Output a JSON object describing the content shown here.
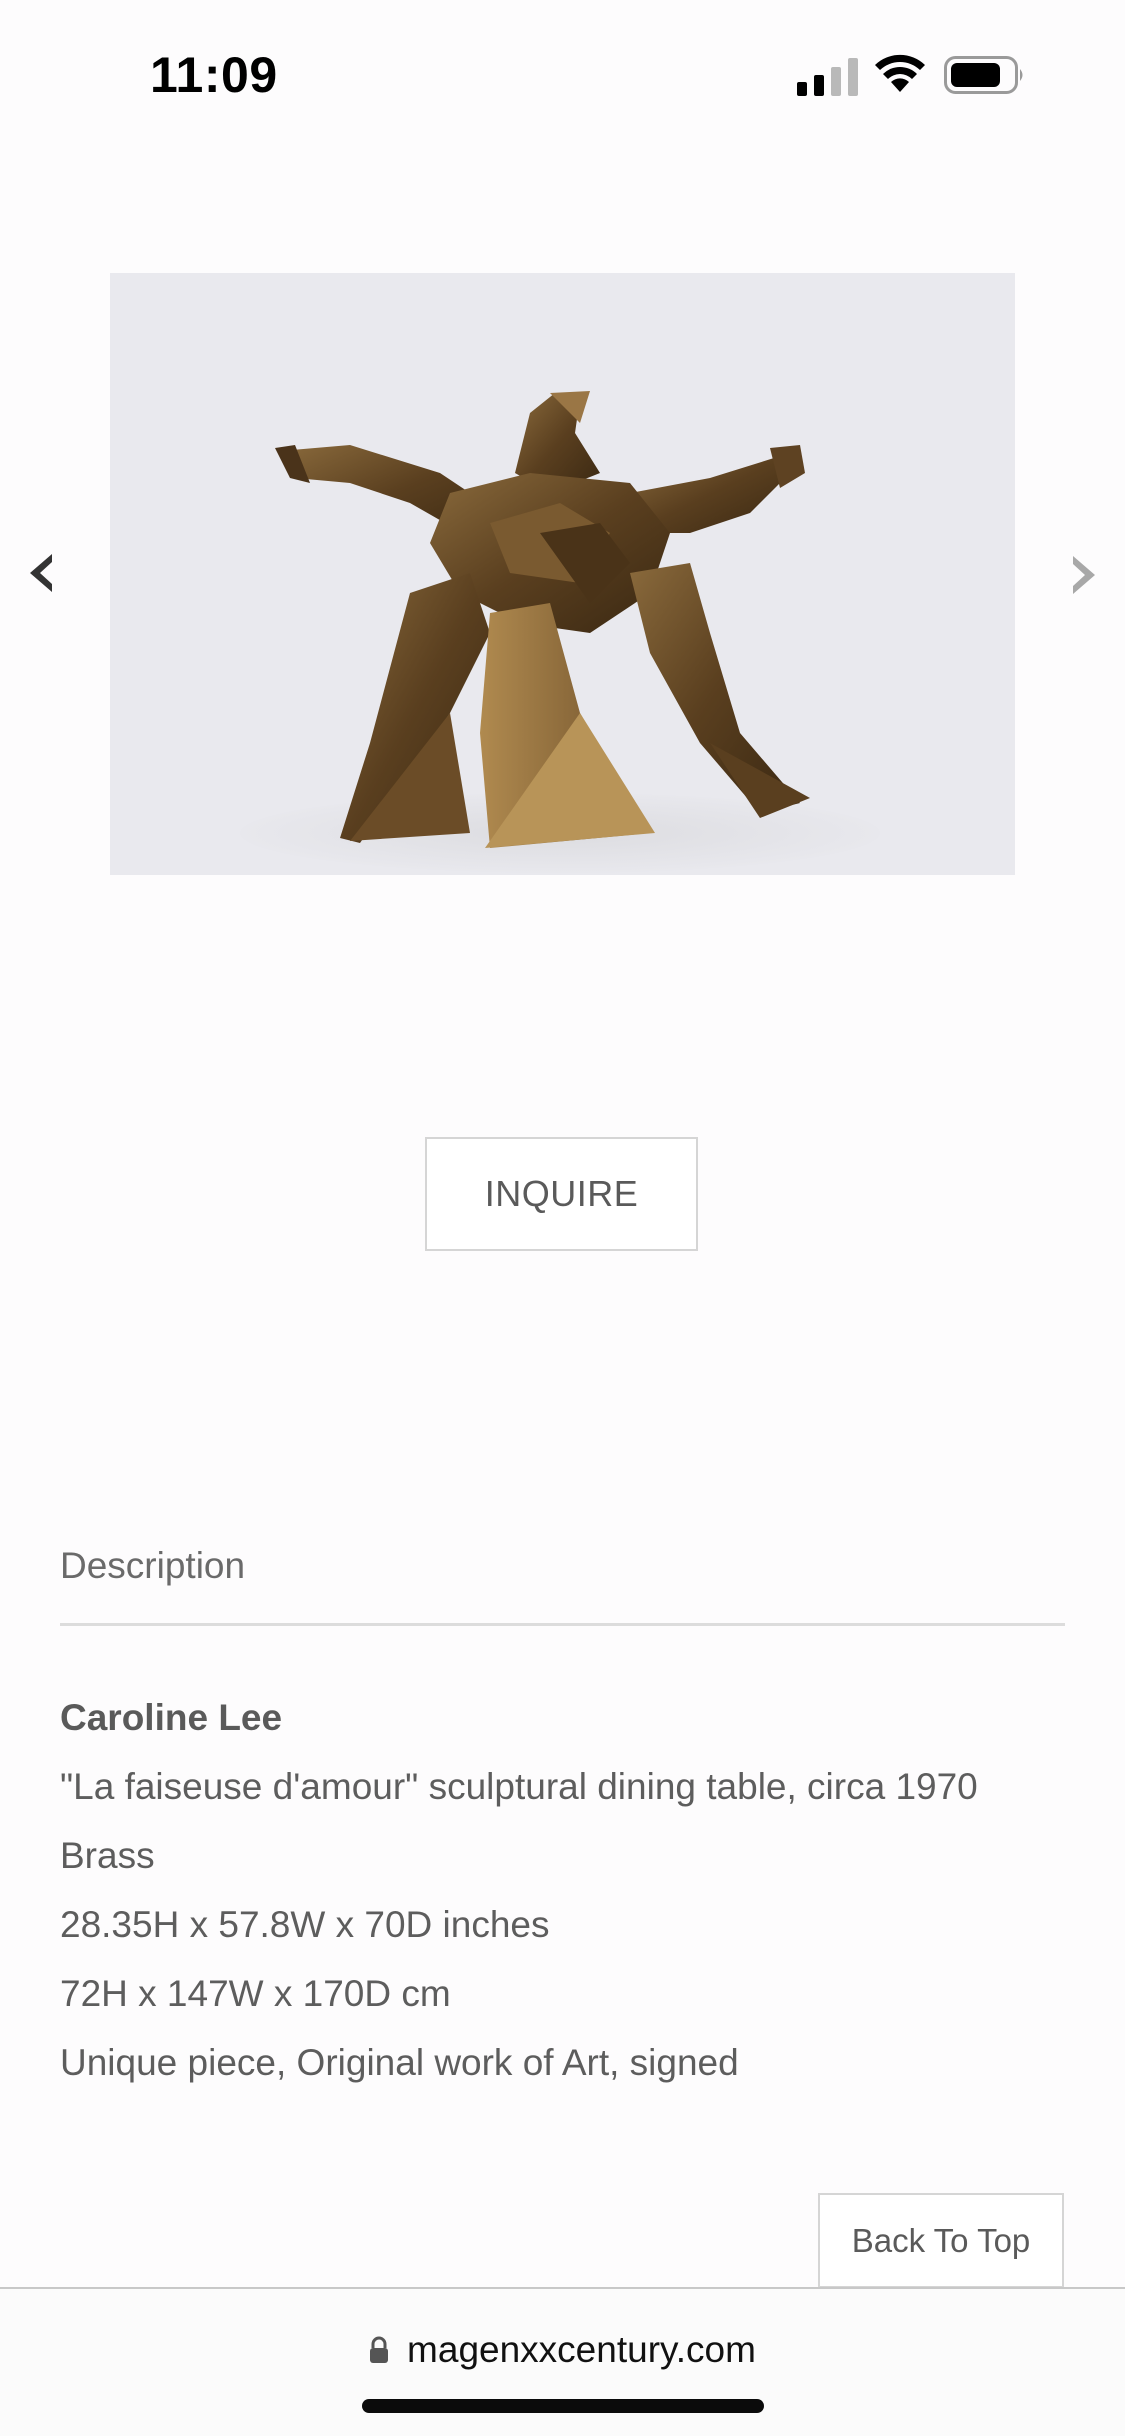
{
  "status_bar": {
    "time": "11:09",
    "icons": [
      "signal-icon",
      "wifi-icon",
      "battery-icon"
    ]
  },
  "gallery": {
    "image_alt": "",
    "prev_icon": "chevron-left-icon",
    "next_icon": "chevron-right-icon"
  },
  "inquire": {
    "label": "INQUIRE"
  },
  "description": {
    "heading": "Description",
    "artist": "Caroline Lee",
    "lines": [
      "\"La faiseuse d'amour\" sculptural dining table, circa 1970",
      "Brass",
      "28.35H x 57.8W x 70D inches",
      "72H x 147W x 170D cm",
      "Unique piece, Original work of Art, signed"
    ]
  },
  "back_to_top": {
    "label": "Back To Top"
  },
  "browser": {
    "url": "magenxxcentury.com",
    "lock_icon": "lock-icon"
  }
}
